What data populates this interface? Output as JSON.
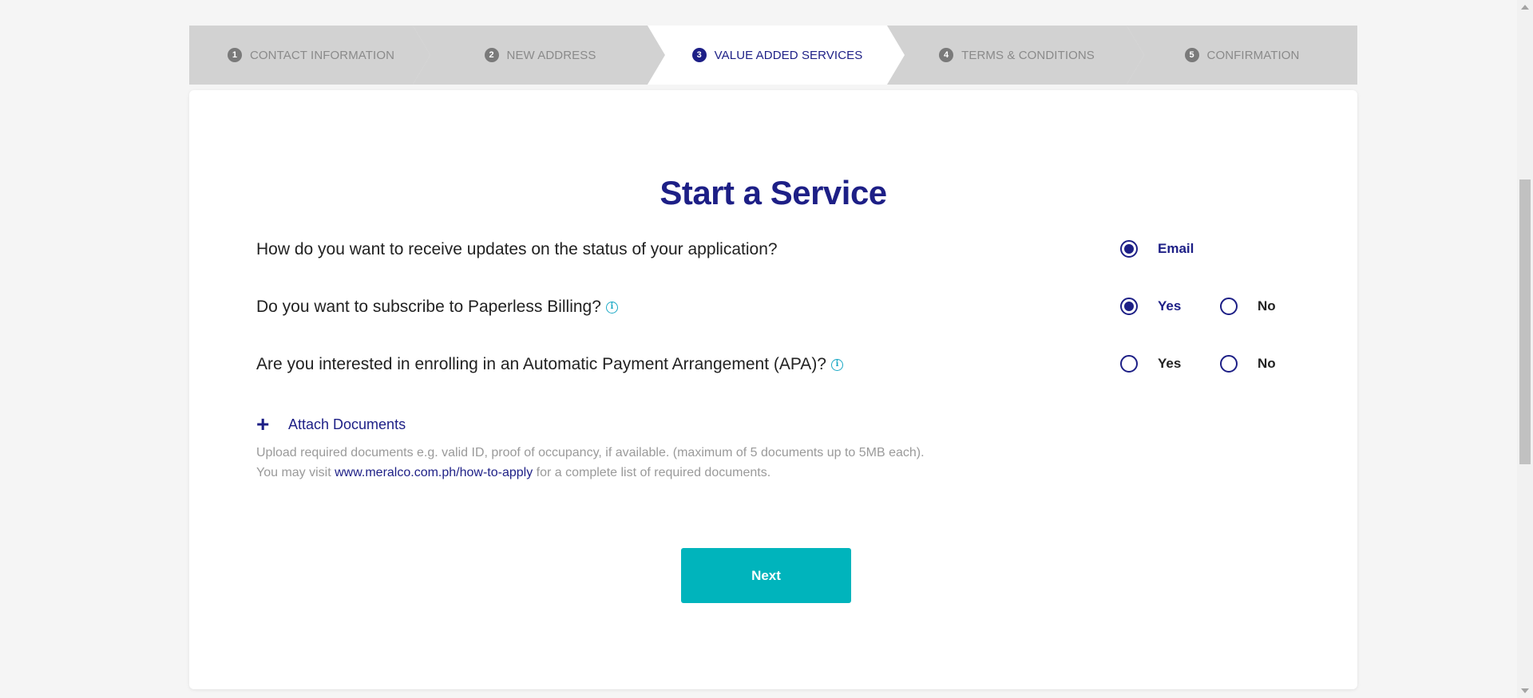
{
  "stepper": {
    "steps": [
      {
        "num": "1",
        "label": "CONTACT INFORMATION",
        "active": false
      },
      {
        "num": "2",
        "label": "NEW ADDRESS",
        "active": false
      },
      {
        "num": "3",
        "label": "VALUE ADDED SERVICES",
        "active": true
      },
      {
        "num": "4",
        "label": "TERMS & CONDITIONS",
        "active": false
      },
      {
        "num": "5",
        "label": "CONFIRMATION",
        "active": false
      }
    ]
  },
  "form": {
    "title": "Start a Service",
    "questions": [
      {
        "text": "How do you want to receive updates on the status of your application?",
        "has_info": false,
        "options": [
          {
            "label": "Email",
            "selected": true
          }
        ]
      },
      {
        "text": "Do you want to subscribe to Paperless Billing?",
        "has_info": true,
        "options": [
          {
            "label": "Yes",
            "selected": true
          },
          {
            "label": "No",
            "selected": false
          }
        ]
      },
      {
        "text": "Are you interested in enrolling in an Automatic Payment Arrangement (APA)?",
        "has_info": true,
        "options": [
          {
            "label": "Yes",
            "selected": false
          },
          {
            "label": "No",
            "selected": false
          }
        ]
      }
    ],
    "attach_label": "Attach Documents",
    "help_line1": "Upload required documents e.g. valid ID, proof of occupancy, if available. (maximum of 5 documents up to 5MB each).",
    "help_line2_prefix": "You may visit ",
    "help_link": "www.meralco.com.ph/how-to-apply",
    "help_line2_suffix": " for a complete list of required documents.",
    "next_label": "Next"
  },
  "info_icon_glyph": "i",
  "colors": {
    "brand": "#1d1f86",
    "accent": "#00b4bc",
    "info": "#1aa8c5"
  }
}
